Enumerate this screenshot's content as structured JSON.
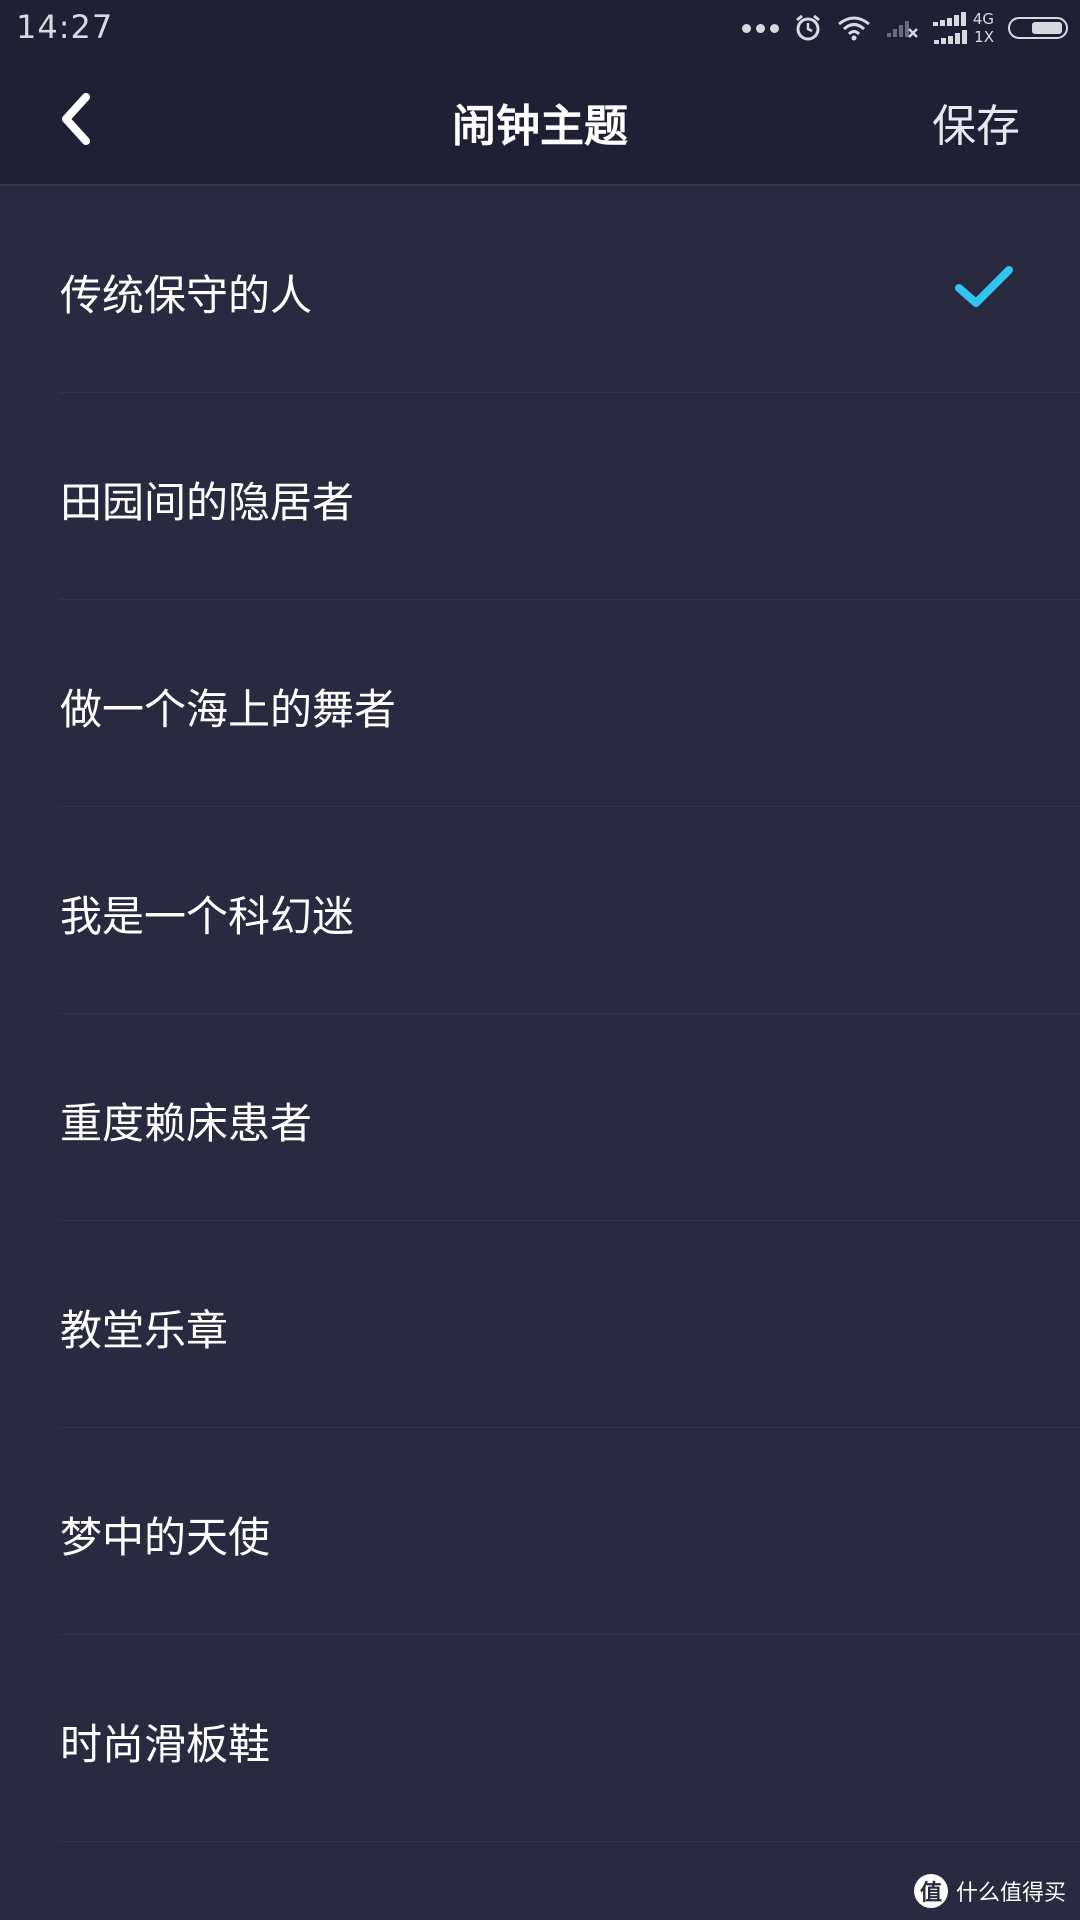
{
  "status_bar": {
    "time": "14:27",
    "net_4g": "4G",
    "net_1x": "1X"
  },
  "nav": {
    "title": "闹钟主题",
    "save_label": "保存"
  },
  "accent_color": "#2ec6f0",
  "themes": [
    {
      "label": "传统保守的人",
      "selected": true
    },
    {
      "label": "田园间的隐居者",
      "selected": false
    },
    {
      "label": "做一个海上的舞者",
      "selected": false
    },
    {
      "label": "我是一个科幻迷",
      "selected": false
    },
    {
      "label": "重度赖床患者",
      "selected": false
    },
    {
      "label": "教堂乐章",
      "selected": false
    },
    {
      "label": "梦中的天使",
      "selected": false
    },
    {
      "label": "时尚滑板鞋",
      "selected": false
    }
  ],
  "watermark": {
    "logo": "值",
    "text": "什么值得买"
  }
}
